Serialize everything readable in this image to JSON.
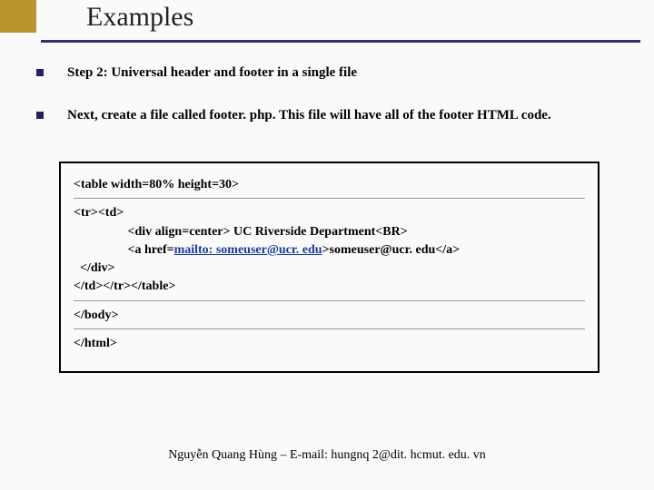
{
  "header": {
    "title": "Examples"
  },
  "bullets": [
    {
      "text": "Step 2: Universal header and footer in a single file"
    },
    {
      "text": "Next, create a file called footer. php. This file will have all of the footer HTML code."
    }
  ],
  "code": {
    "line1": "<table width=80% height=30>",
    "line2": "<tr><td>",
    "line3_indent": "                 <div align=center> UC Riverside Department<BR>",
    "line4_pre": "                 <a href=",
    "line4_link": "mailto: someuser@ucr. edu",
    "line4_post": ">someuser@ucr. edu</a>",
    "line5": "  </div>",
    "line6": "</td></tr></table>",
    "line7": "</body>",
    "line8": "</html>"
  },
  "footer": {
    "credit": "Nguyễn Quang Hùng – E-mail: hungnq 2@dit. hcmut. edu. vn"
  }
}
